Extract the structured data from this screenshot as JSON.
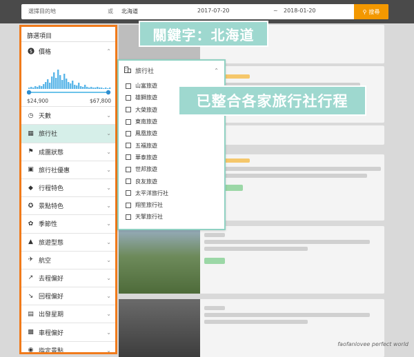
{
  "search": {
    "destination_placeholder": "選擇目的地",
    "or_label": "或",
    "keyword": "北海道",
    "date_start": "2017-07-20",
    "tilde": "~",
    "date_end": "2018-01-20",
    "search_label": "搜尋"
  },
  "sidebar": {
    "title": "篩選項目",
    "price_label": "價格",
    "price_min": "$24,900",
    "price_max": "$67,800",
    "items": [
      {
        "label": "天數",
        "icon": "clock-icon"
      },
      {
        "label": "旅行社",
        "icon": "building-icon"
      },
      {
        "label": "成團狀態",
        "icon": "flag-icon"
      },
      {
        "label": "旅行社優惠",
        "icon": "voucher-icon"
      },
      {
        "label": "行程特色",
        "icon": "tag-icon"
      },
      {
        "label": "景點特色",
        "icon": "star-circle-icon"
      },
      {
        "label": "季節性",
        "icon": "flower-icon"
      },
      {
        "label": "旅遊型態",
        "icon": "mountain-icon"
      },
      {
        "label": "航空",
        "icon": "plane-icon"
      },
      {
        "label": "去程偏好",
        "icon": "takeoff-icon"
      },
      {
        "label": "回程偏好",
        "icon": "landing-icon"
      },
      {
        "label": "出發星期",
        "icon": "calendar-icon"
      },
      {
        "label": "車程偏好",
        "icon": "bus-icon"
      },
      {
        "label": "指定景點",
        "icon": "camera-icon"
      }
    ]
  },
  "agency_panel": {
    "title": "旅行社",
    "options": [
      "山富旅遊",
      "雄獅旅遊",
      "大榮旅遊",
      "東南旅遊",
      "鳳凰旅遊",
      "五福旅遊",
      "華泰旅遊",
      "世邦旅遊",
      "良友旅遊",
      "太平洋旅行社",
      "翔笙旅行社",
      "天擎旅行社"
    ]
  },
  "callouts": {
    "keyword_note": "關鍵字：北海道",
    "agency_note": "已整合各家旅行社行程"
  },
  "watermark": "faofanlovee perfect world",
  "colors": {
    "accent_orange": "#f39800",
    "sidebar_border": "#f07a1a",
    "callout_teal": "#9ed8cf",
    "histogram_blue": "#5bb6e8"
  }
}
